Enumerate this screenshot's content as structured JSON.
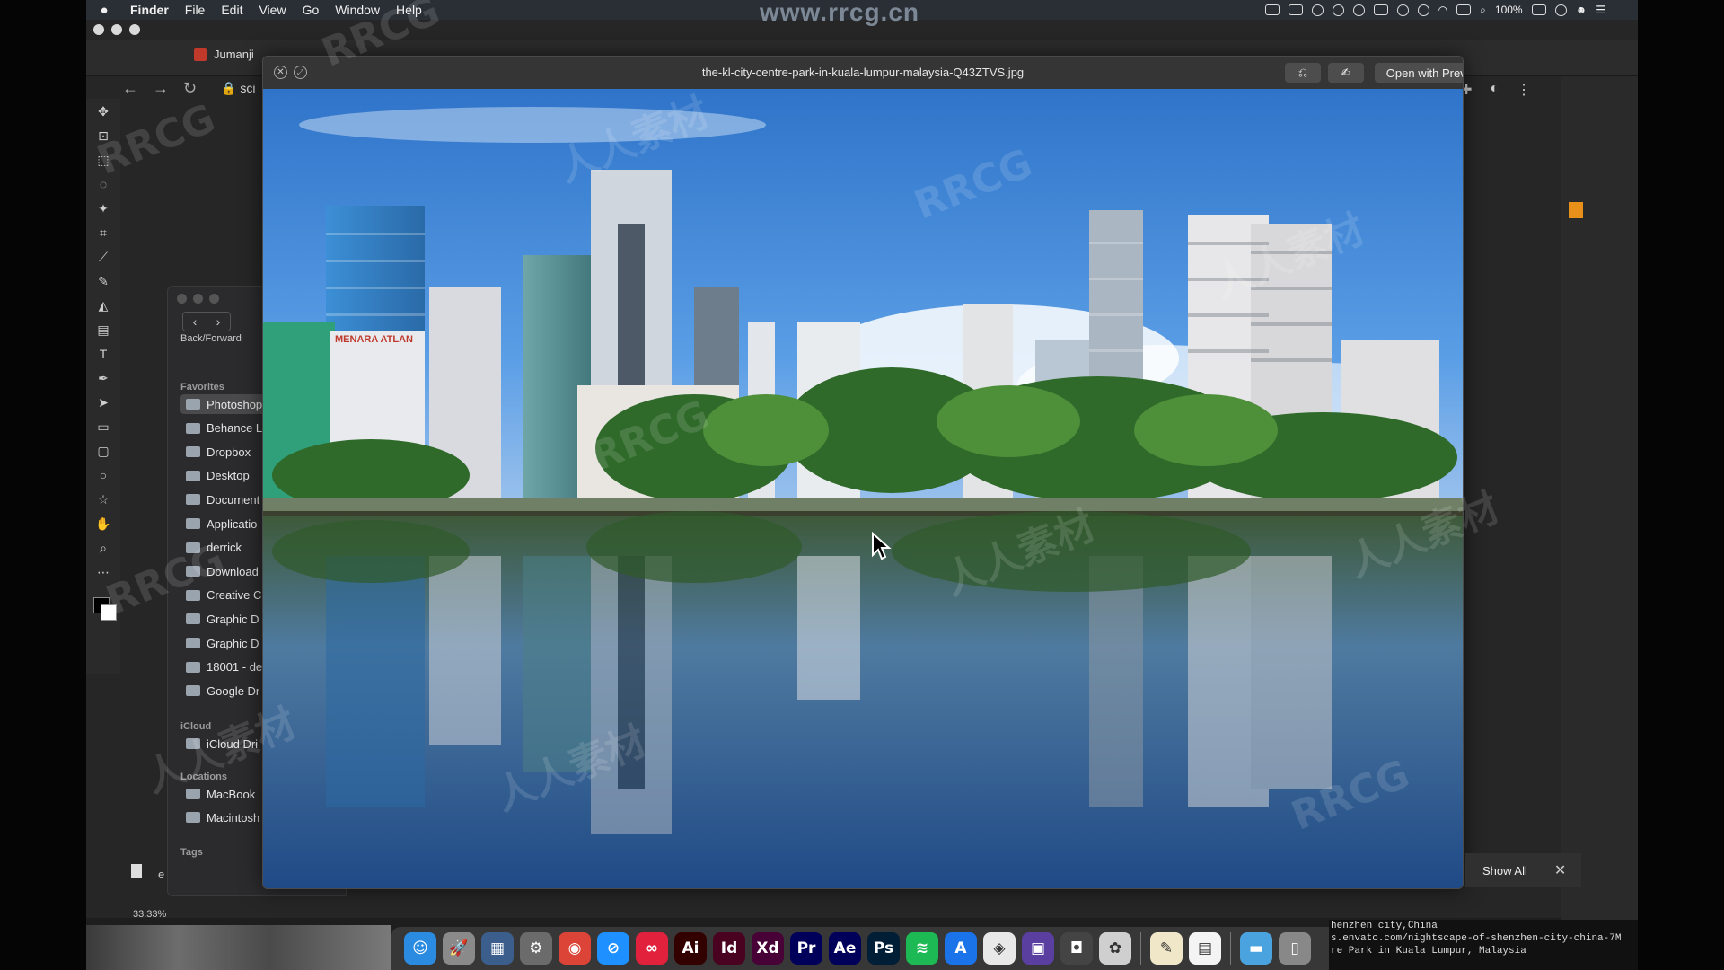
{
  "menubar": {
    "apple": "",
    "items": [
      "Finder",
      "File",
      "Edit",
      "View",
      "Go",
      "Window",
      "Help"
    ],
    "site_overlay": "www.rrcg.cn",
    "battery": "100%"
  },
  "photoshop": {
    "tab_title": "Jumanji",
    "url_fragment": "sci",
    "zoom": "33.33%",
    "doc_label": "e"
  },
  "finder": {
    "nav_label": "Back/Forward",
    "sections": {
      "favorites": "Favorites",
      "icloud": "iCloud",
      "locations": "Locations",
      "tags": "Tags"
    },
    "favorites": [
      "Photoshop",
      "Behance L",
      "Dropbox",
      "Desktop",
      "Document",
      "Applicatio",
      "derrick",
      "Download",
      "Creative C",
      "Graphic D",
      "Graphic D",
      "18001 - de",
      "Google Dr"
    ],
    "icloud": [
      "iCloud Dri"
    ],
    "locations": [
      "MacBook",
      "Macintosh"
    ]
  },
  "quicklook": {
    "filename": "the-kl-city-centre-park-in-kuala-lumpur-malaysia-Q43ZTVS.jpg",
    "open_button": "Open with Preview",
    "building_sign": "MENARA ATLAN"
  },
  "bottom": {
    "show_all": "Show All",
    "close": "✕"
  },
  "dock": {
    "apps": [
      {
        "name": "finder",
        "label": "☺",
        "color": "#2a8be0"
      },
      {
        "name": "launchpad",
        "label": "🚀",
        "color": "#8a8a8a"
      },
      {
        "name": "mission-control",
        "label": "▦",
        "color": "#3b5e8c"
      },
      {
        "name": "system-preferences",
        "label": "⚙",
        "color": "#6b6b6b"
      },
      {
        "name": "chrome",
        "label": "◉",
        "color": "#db4437"
      },
      {
        "name": "safari",
        "label": "⊘",
        "color": "#1e90ff"
      },
      {
        "name": "creative-cloud",
        "label": "∞",
        "color": "#e2223d"
      },
      {
        "name": "illustrator",
        "label": "Ai",
        "color": "#330000"
      },
      {
        "name": "indesign",
        "label": "Id",
        "color": "#49021f"
      },
      {
        "name": "xd",
        "label": "Xd",
        "color": "#470137"
      },
      {
        "name": "premiere",
        "label": "Pr",
        "color": "#00005b"
      },
      {
        "name": "after-effects",
        "label": "Ae",
        "color": "#00005b"
      },
      {
        "name": "photoshop",
        "label": "Ps",
        "color": "#001e36"
      },
      {
        "name": "spotify",
        "label": "≋",
        "color": "#1db954"
      },
      {
        "name": "app-store",
        "label": "A",
        "color": "#1a73e8"
      },
      {
        "name": "shield-app",
        "label": "◈",
        "color": "#e8e8e8"
      },
      {
        "name": "screen-tool",
        "label": "▣",
        "color": "#5a3fa0"
      },
      {
        "name": "cassette-app",
        "label": "◘",
        "color": "#444444"
      },
      {
        "name": "color-app",
        "label": "✿",
        "color": "#cfcfcf"
      },
      {
        "name": "textedit",
        "label": "✎",
        "color": "#f0e6c8"
      },
      {
        "name": "preview",
        "label": "▤",
        "color": "#f4f4f4"
      },
      {
        "name": "folder",
        "label": "▬",
        "color": "#4aa3df"
      },
      {
        "name": "trash",
        "label": "▯",
        "color": "#888888"
      }
    ]
  },
  "terminal": {
    "lines": [
      "henzhen city,China",
      "s.envato.com/nightscape-of-shenzhen-city-china-7M",
      "",
      "re Park in Kuala Lumpur, Malaysia"
    ]
  },
  "watermarks": [
    "RRCG",
    "人人素材"
  ]
}
